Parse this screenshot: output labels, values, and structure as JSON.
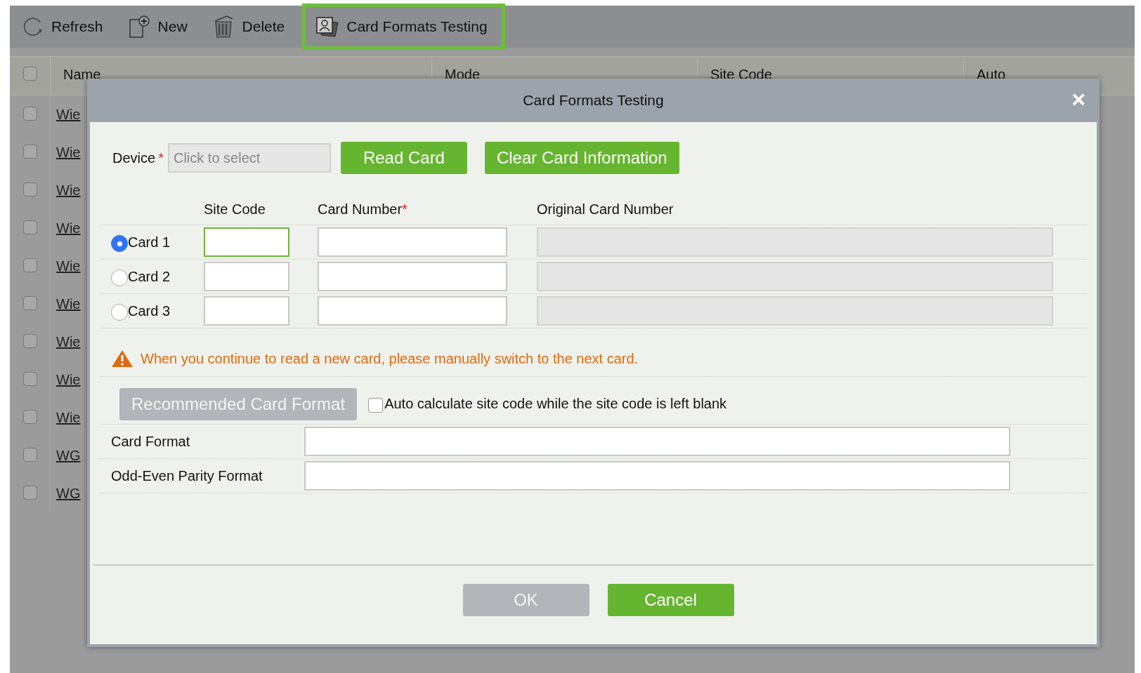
{
  "toolbar": [
    {
      "kind": "refresh",
      "label": "Refresh",
      "highlighted": false
    },
    {
      "kind": "new",
      "label": "New",
      "highlighted": false
    },
    {
      "kind": "delete",
      "label": "Delete",
      "highlighted": false
    },
    {
      "kind": "cards",
      "label": "Card Formats Testing",
      "highlighted": true
    }
  ],
  "table": {
    "select_all": {
      "checked": false
    },
    "columns": [
      "Name",
      "Mode",
      "Site Code",
      "Auto"
    ],
    "rows": [
      {
        "name": "Wie",
        "checked": false
      },
      {
        "name": "Wie",
        "checked": false
      },
      {
        "name": "Wie",
        "checked": false
      },
      {
        "name": "Wie",
        "checked": false
      },
      {
        "name": "Wie",
        "checked": false
      },
      {
        "name": "Wie",
        "checked": false
      },
      {
        "name": "Wie",
        "checked": false
      },
      {
        "name": "Wie",
        "checked": false
      },
      {
        "name": "Wie",
        "checked": false
      },
      {
        "name": "WG",
        "checked": false
      },
      {
        "name": "WG",
        "checked": false
      }
    ]
  },
  "dialog": {
    "title": "Card Formats Testing",
    "close": "×",
    "device": {
      "label": "Device",
      "required_mark": "*",
      "placeholder": "Click to select"
    },
    "actions": [
      {
        "label": "Read Card"
      },
      {
        "label": "Clear Card Information"
      }
    ],
    "card_table": {
      "columns": [
        {
          "label": "Site Code"
        },
        {
          "label": "Card Number",
          "required_mark": "*"
        },
        {
          "label": "Original Card Number"
        }
      ],
      "rows": [
        {
          "label": "Card 1",
          "selected": true
        },
        {
          "label": "Card 2",
          "selected": false
        },
        {
          "label": "Card 3",
          "selected": false
        }
      ]
    },
    "warning": "When you continue to read a new card, please manually switch to the next card.",
    "recommended_button": {
      "label": "Recommended Card Format",
      "disabled": true
    },
    "auto_calculate": {
      "label": "Auto calculate site code while the site code is left blank",
      "checked": false
    },
    "fields": [
      {
        "label": "Card Format"
      },
      {
        "label": "Odd-Even Parity Format"
      }
    ],
    "footer_buttons": [
      {
        "label": "OK",
        "disabled": true
      },
      {
        "label": "Cancel",
        "disabled": false
      }
    ]
  }
}
